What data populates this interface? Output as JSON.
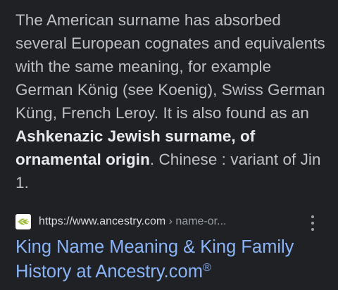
{
  "snippet": {
    "text_before_bold": "The American surname has absorbed several European cognates and equivalents with the same meaning, for example German König (see Koenig), Swiss German Küng, French Leroy. It is also found as an ",
    "bold_text": "Ashkenazic Jewish surname, of ornamental origin",
    "text_after_bold": ". Chinese : variant of Jin 1."
  },
  "source": {
    "favicon_icon": "ancestry-leaf-icon",
    "favicon_color": "#9cbe30",
    "url_domain": "https://www.ancestry.com",
    "url_path": " › name-or..."
  },
  "result": {
    "title": "King Name Meaning & King Family History at Ancestry.com",
    "title_suffix": "®"
  },
  "menu": {
    "icon": "more-vert-icon"
  },
  "colors": {
    "background": "#202124",
    "snippet_text": "#bdc1c6",
    "link": "#8ab4f8"
  }
}
